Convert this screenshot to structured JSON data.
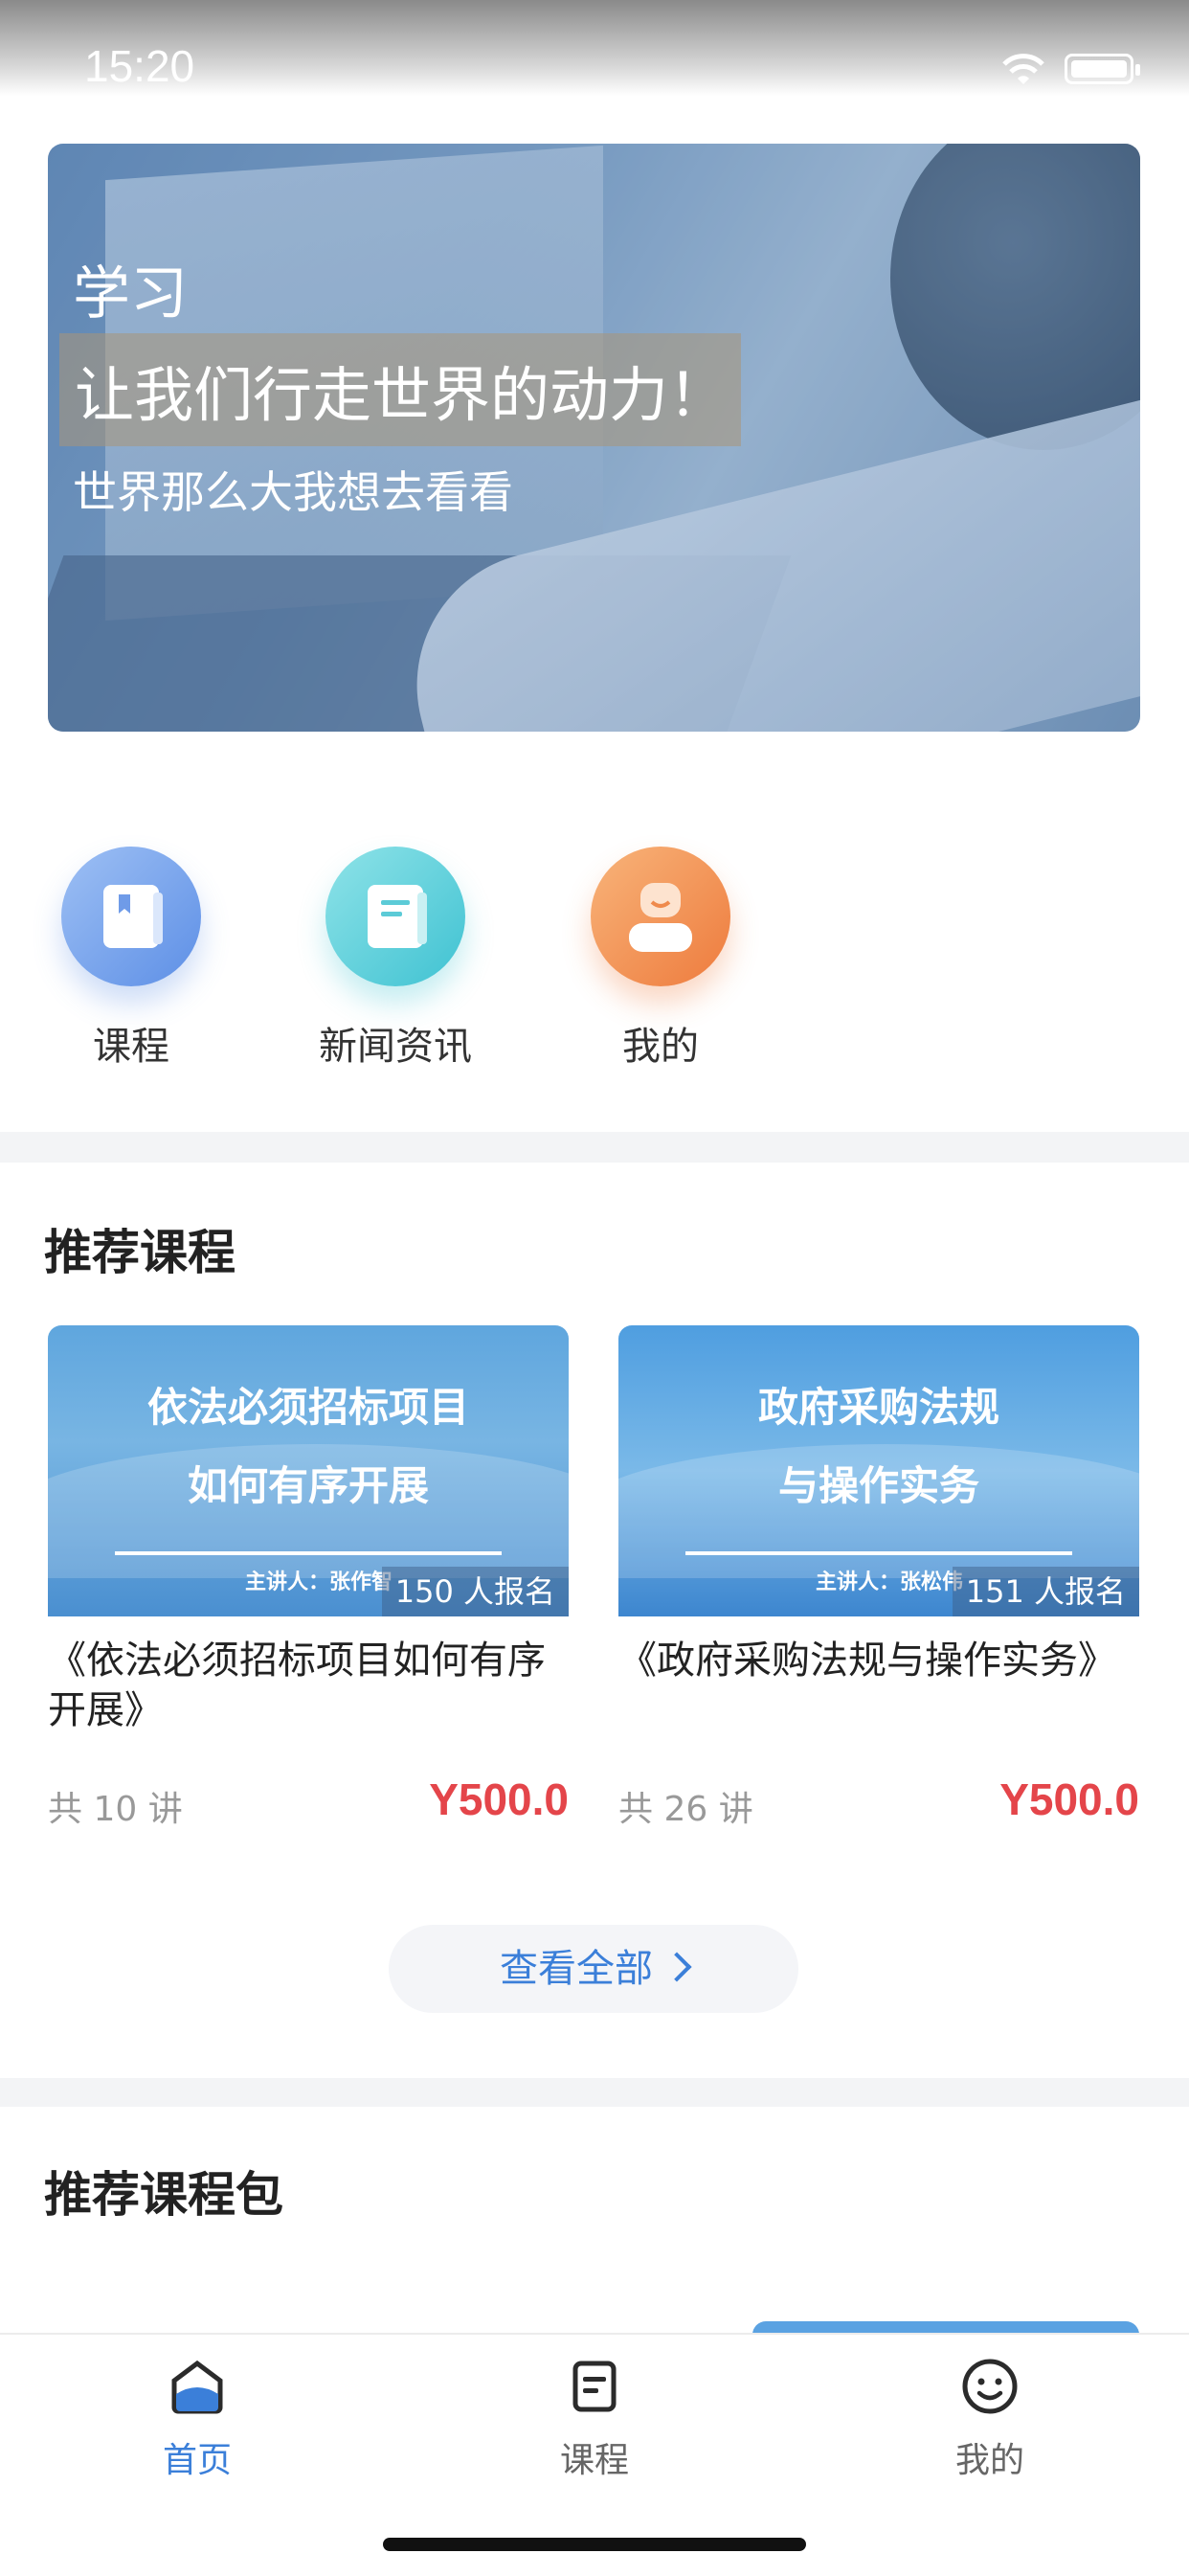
{
  "status_bar": {
    "time": "15:20"
  },
  "banner": {
    "title": "学习",
    "slogan": "让我们行走世界的动力！",
    "subtitle": "世界那么大我想去看看"
  },
  "quick_nav": [
    {
      "label": "课程",
      "icon": "book-icon"
    },
    {
      "label": "新闻资讯",
      "icon": "news-icon"
    },
    {
      "label": "我的",
      "icon": "user-icon"
    }
  ],
  "recommended_courses": {
    "title": "推荐课程",
    "items": [
      {
        "cover_line1": "依法必须招标项目",
        "cover_line2": "如何有序开展",
        "speaker": "主讲人：张作智",
        "enrollment": "150 人报名",
        "name": "《依法必须招标项目如何有序开展》",
        "lectures": "共 10 讲",
        "price": "Y500.0"
      },
      {
        "cover_line1": "政府采购法规",
        "cover_line2": "与操作实务",
        "speaker": "主讲人：张松伟",
        "enrollment": "151 人报名",
        "name": "《政府采购法规与操作实务》",
        "lectures": "共 26 讲",
        "price": "Y500.0"
      }
    ],
    "view_all": "查看全部"
  },
  "recommended_packages": {
    "title": "推荐课程包"
  },
  "tab_bar": [
    {
      "label": "首页",
      "icon": "home-icon",
      "active": true
    },
    {
      "label": "课程",
      "icon": "course-icon",
      "active": false
    },
    {
      "label": "我的",
      "icon": "smiley-icon",
      "active": false
    }
  ],
  "colors": {
    "accent": "#3b7fd9",
    "price": "#e4454a"
  }
}
